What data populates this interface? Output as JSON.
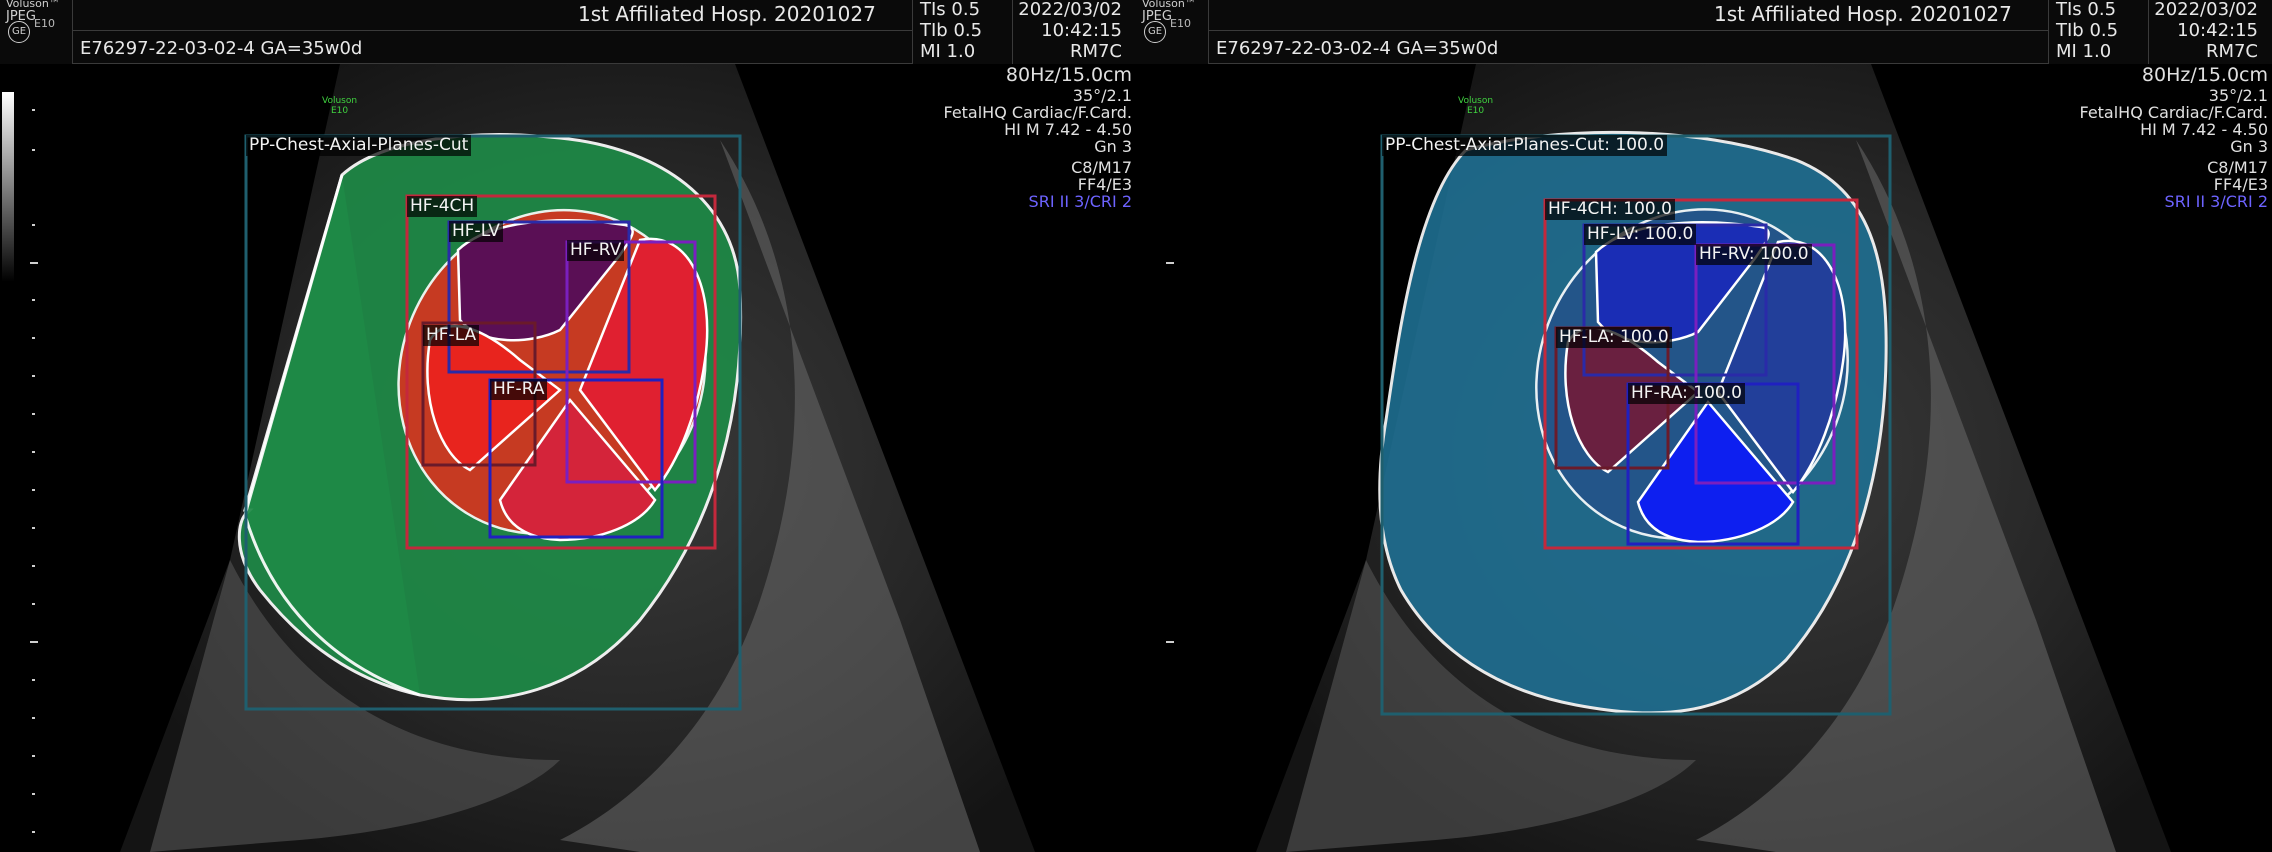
{
  "header": {
    "brand": "Voluson™",
    "format": "JPEG",
    "ge_logo": "GE",
    "model": "E10",
    "hospital": "1st Affiliated Hosp. 20201027",
    "patient": "E76297-22-03-02-4  GA=35w0d",
    "tis": "TIs  0.5",
    "tib": "TIb  0.5",
    "mi": "MI   1.0",
    "date": "2022/03/02",
    "time": "10:42:15",
    "probe": "RM7C"
  },
  "side_info": {
    "freq_depth": "80Hz/15.0cm",
    "angle": "35°/2.1",
    "preset": "FetalHQ Cardiac/F.Card.",
    "hi_m": "HI M  7.42 - 4.50",
    "gain": "Gn  3",
    "c_m": "C8/M17",
    "ff_e": "FF4/E3",
    "sri": "SRI II 3/CRI 2"
  },
  "scanner_badge": {
    "line1": "Voluson",
    "line2": "E10"
  },
  "left_panel": {
    "labels": {
      "chest": "PP-Chest-Axial-Planes-Cut",
      "fourch": "HF-4CH",
      "lv": "HF-LV",
      "rv": "HF-RV",
      "la": "HF-LA",
      "ra": "HF-RA"
    },
    "colors": {
      "chest_fill": "#1e8a47",
      "heart_fill": "#d9331f",
      "lv_fill": "#5a0f55",
      "chambers_fill": "#e02030"
    }
  },
  "right_panel": {
    "labels": {
      "chest": "PP-Chest-Axial-Planes-Cut: 100.0",
      "fourch": "HF-4CH: 100.0",
      "lv": "HF-LV: 100.0",
      "rv": "HF-RV: 100.0",
      "la": "HF-LA: 100.0",
      "ra": "HF-RA: 100.0"
    },
    "colors": {
      "chest_fill": "#1f6f92",
      "heart_fill": "#24538a",
      "lv_fill": "#1a2db5",
      "la_fill": "#6a2040",
      "ra_fill": "#0d1ff0"
    }
  },
  "box_colors": {
    "chest": "#1f5f6e",
    "fourch": "#c4283c",
    "lv": "#2a2aa8",
    "rv": "#7a1fbf",
    "la": "#6a1a2a",
    "ra": "#2020c0"
  }
}
